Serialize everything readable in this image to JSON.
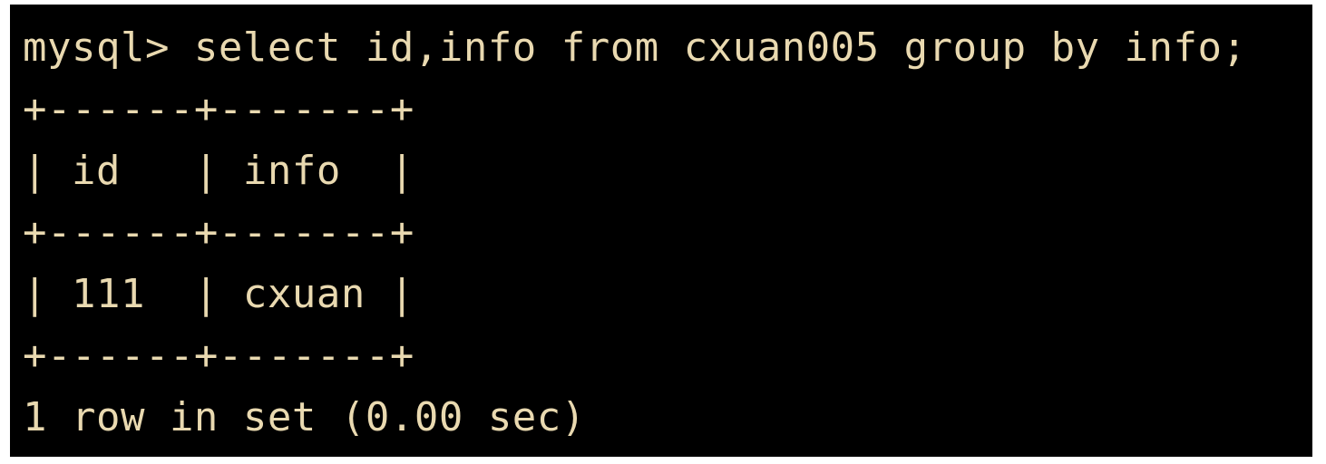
{
  "terminal": {
    "text_color": "#e9d9b0",
    "background_color": "#000000",
    "lines": [
      "mysql> select id,info from cxuan005 group by info;",
      "+------+-------+",
      "| id   | info  |",
      "+------+-------+",
      "| 111  | cxuan |",
      "+------+-------+",
      "1 row in set (0.00 sec)"
    ]
  }
}
